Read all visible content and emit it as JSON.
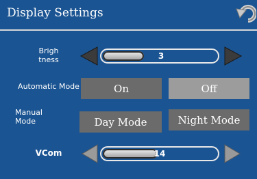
{
  "header": {
    "title": "Display Settings",
    "back_icon": "back-arrow-icon"
  },
  "brightness": {
    "label": "Brigh tness",
    "value": "3",
    "decrease_icon": "arrow-left-icon",
    "increase_icon": "arrow-right-icon"
  },
  "automatic_mode": {
    "label": "Automatic Mode",
    "options": [
      "On",
      "Off"
    ],
    "selected": "Off"
  },
  "manual_mode": {
    "label": "Manual Mode",
    "options": [
      "Day Mode",
      "Night Mode"
    ]
  },
  "vcom": {
    "label": "VCom",
    "value": "14",
    "decrease_icon": "arrow-left-icon",
    "increase_icon": "arrow-right-icon"
  },
  "colors": {
    "background": "#1b5492",
    "button_dark": "#6b6b6b",
    "button_light": "#9c9c9c"
  }
}
